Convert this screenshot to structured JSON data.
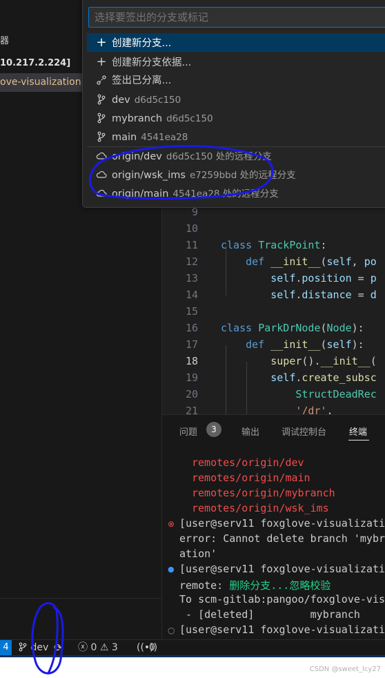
{
  "sidebar": {
    "header_fragment": "器",
    "host": "10.217.2.224]",
    "folder": "ove-visualization"
  },
  "editor": {
    "lines": [
      {
        "n": "9",
        "text": ""
      },
      {
        "n": "10",
        "text": ""
      },
      {
        "n": "11",
        "text": "class TrackPoint:"
      },
      {
        "n": "12",
        "text": "    def __init__(self, po"
      },
      {
        "n": "13",
        "text": "        self.position = p"
      },
      {
        "n": "14",
        "text": "        self.distance = d"
      },
      {
        "n": "15",
        "text": ""
      },
      {
        "n": "16",
        "text": "class ParkDrNode(Node):"
      },
      {
        "n": "17",
        "text": "    def __init__(self):"
      },
      {
        "n": "18",
        "text": "        super().__init__("
      },
      {
        "n": "19",
        "text": "        self.create_subsc"
      },
      {
        "n": "20",
        "text": "            StructDeadRec"
      },
      {
        "n": "21",
        "text": "            '/dr',"
      }
    ]
  },
  "panel": {
    "tabs": [
      "问题",
      "输出",
      "调试控制台",
      "终端"
    ],
    "problems_count": "3",
    "terminal": {
      "remotes": [
        "remotes/origin/dev",
        "remotes/origin/main",
        "remotes/origin/mybranch",
        "remotes/origin/wsk_ims"
      ],
      "line1": "[user@serv11 foxglove-visualizati",
      "line2": "error: Cannot delete branch 'mybr",
      "line3": "ation'",
      "line4": "[user@serv11 foxglove-visualizati",
      "line5_prefix": "remote: ",
      "line5_msg": "删除分支...忽略校验",
      "line6": "To scm-gitlab:pangoo/foxglove-vis",
      "line7": " - [deleted]         mybranch",
      "line8": "[user@serv11 foxglove-visualizati"
    }
  },
  "statusbar": {
    "remote": "4",
    "branch": "dev",
    "errors": "0",
    "warnings": "3",
    "ports": "0"
  },
  "quickpick": {
    "placeholder": "选择要签出的分支或标记",
    "actions": [
      {
        "label": "创建新分支...",
        "icon": "plus-icon"
      },
      {
        "label": "创建新分支依据...",
        "icon": "plus-icon"
      },
      {
        "label": "签出已分离...",
        "icon": "git-detached-icon"
      }
    ],
    "local_branches": [
      {
        "name": "dev",
        "hash": "d6d5c150"
      },
      {
        "name": "mybranch",
        "hash": "d6d5c150"
      },
      {
        "name": "main",
        "hash": "4541ea28"
      }
    ],
    "remote_branches": [
      {
        "name": "origin/dev",
        "desc": "d6d5c150 处的远程分支"
      },
      {
        "name": "origin/wsk_ims",
        "desc": "e7259bbd 处的远程分支"
      },
      {
        "name": "origin/main",
        "desc": "4541ea28 处的远程分支"
      }
    ]
  },
  "watermark": "CSDN @sweet_lcy27",
  "colors": {
    "accent": "#0078d4",
    "focused_row": "#04395e",
    "annotation": "#1a1ae6"
  }
}
